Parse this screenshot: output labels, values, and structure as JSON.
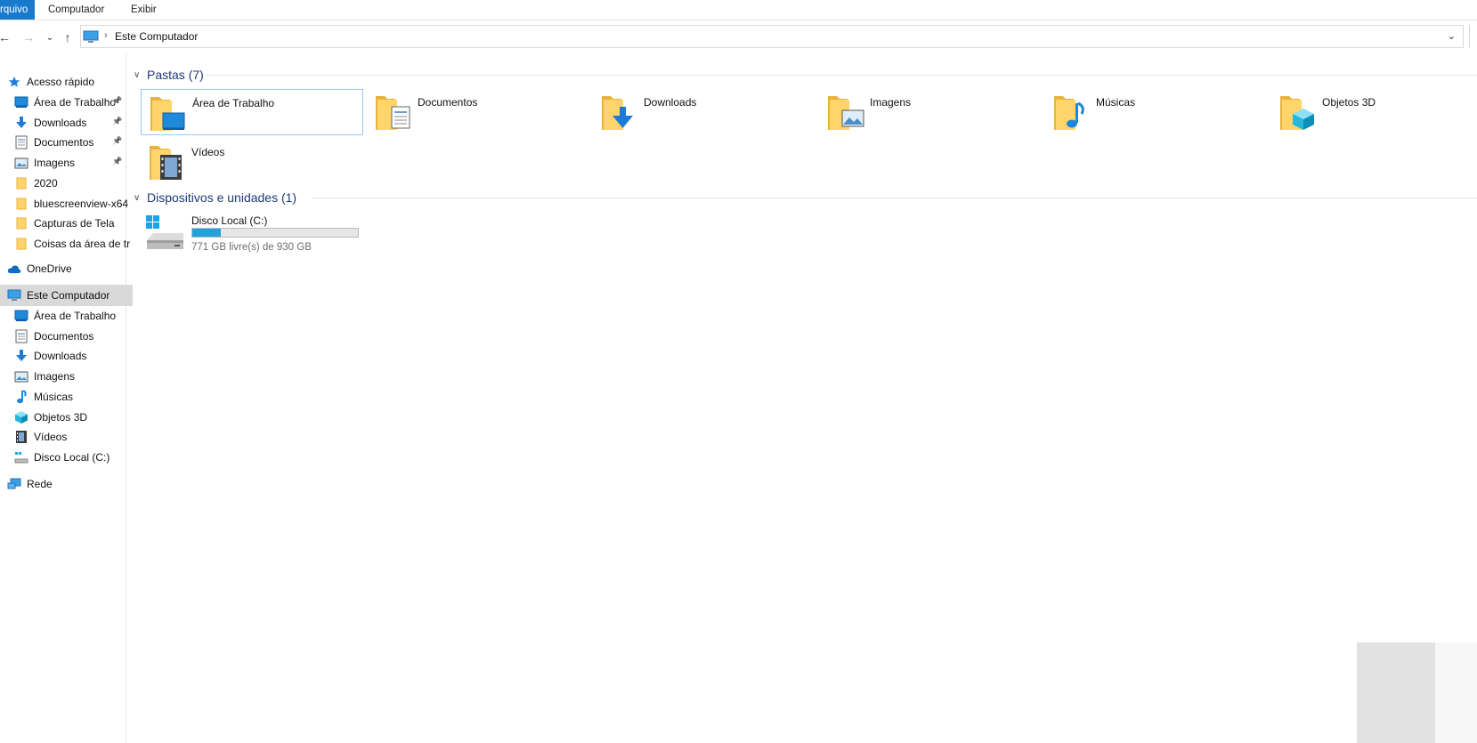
{
  "ribbon": {
    "tabs": [
      "rquivo",
      "Computador",
      "Exibir"
    ]
  },
  "address": {
    "crumb": "Este Computador"
  },
  "nav": {
    "quick_access": "Acesso rápido",
    "quick_items": [
      {
        "label": "Área de Trabalho",
        "icon": "desktop-icon",
        "pinned": true
      },
      {
        "label": "Downloads",
        "icon": "download-icon",
        "pinned": true
      },
      {
        "label": "Documentos",
        "icon": "document-icon",
        "pinned": true
      },
      {
        "label": "Imagens",
        "icon": "image-icon",
        "pinned": true
      },
      {
        "label": "2020",
        "icon": "folder-icon",
        "pinned": false
      },
      {
        "label": "bluescreenview-x64",
        "icon": "folder-icon",
        "pinned": false
      },
      {
        "label": "Capturas de Tela",
        "icon": "folder-icon",
        "pinned": false
      },
      {
        "label": "Coisas da área de tr",
        "icon": "folder-icon",
        "pinned": false
      }
    ],
    "onedrive": "OneDrive",
    "this_pc": "Este Computador",
    "pc_items": [
      {
        "label": "Área de Trabalho",
        "icon": "desktop-icon"
      },
      {
        "label": "Documentos",
        "icon": "document-icon"
      },
      {
        "label": "Downloads",
        "icon": "download-icon"
      },
      {
        "label": "Imagens",
        "icon": "image-icon"
      },
      {
        "label": "Músicas",
        "icon": "music-icon"
      },
      {
        "label": "Objetos 3D",
        "icon": "cube-icon"
      },
      {
        "label": "Vídeos",
        "icon": "video-icon"
      },
      {
        "label": "Disco Local (C:)",
        "icon": "drive-icon"
      }
    ],
    "network": "Rede"
  },
  "folders_group": "Pastas (7)",
  "folders": [
    {
      "label": "Área de Trabalho",
      "overlay": "desktop"
    },
    {
      "label": "Documentos",
      "overlay": "document"
    },
    {
      "label": "Downloads",
      "overlay": "download"
    },
    {
      "label": "Imagens",
      "overlay": "image"
    },
    {
      "label": "Músicas",
      "overlay": "music"
    },
    {
      "label": "Objetos 3D",
      "overlay": "cube"
    },
    {
      "label": "Vídeos",
      "overlay": "video"
    }
  ],
  "devices_group": "Dispositivos e unidades (1)",
  "drive": {
    "name": "Disco Local (C:)",
    "free_text": "771 GB livre(s) de 930 GB",
    "used_fraction": 0.171
  },
  "colors": {
    "accent": "#1979ca",
    "group_text": "#1e3a78",
    "drive_bar": "#26a0da"
  }
}
